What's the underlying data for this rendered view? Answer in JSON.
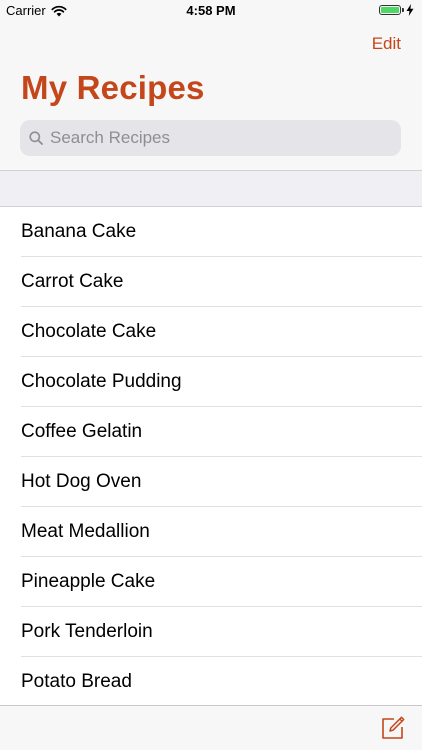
{
  "status_bar": {
    "carrier": "Carrier",
    "time": "4:58 PM",
    "battery_level": 1.0
  },
  "header": {
    "edit_label": "Edit",
    "title": "My Recipes",
    "search_placeholder": "Search Recipes"
  },
  "recipes": [
    {
      "name": "Banana Cake"
    },
    {
      "name": "Carrot Cake"
    },
    {
      "name": "Chocolate Cake"
    },
    {
      "name": "Chocolate Pudding"
    },
    {
      "name": "Coffee Gelatin"
    },
    {
      "name": "Hot Dog Oven"
    },
    {
      "name": "Meat Medallion"
    },
    {
      "name": "Pineapple Cake"
    },
    {
      "name": "Pork Tenderloin"
    },
    {
      "name": "Potato Bread"
    }
  ],
  "toolbar": {
    "compose_icon": "compose-icon"
  },
  "colors": {
    "accent": "#c4471b",
    "battery": "#4cd964"
  }
}
